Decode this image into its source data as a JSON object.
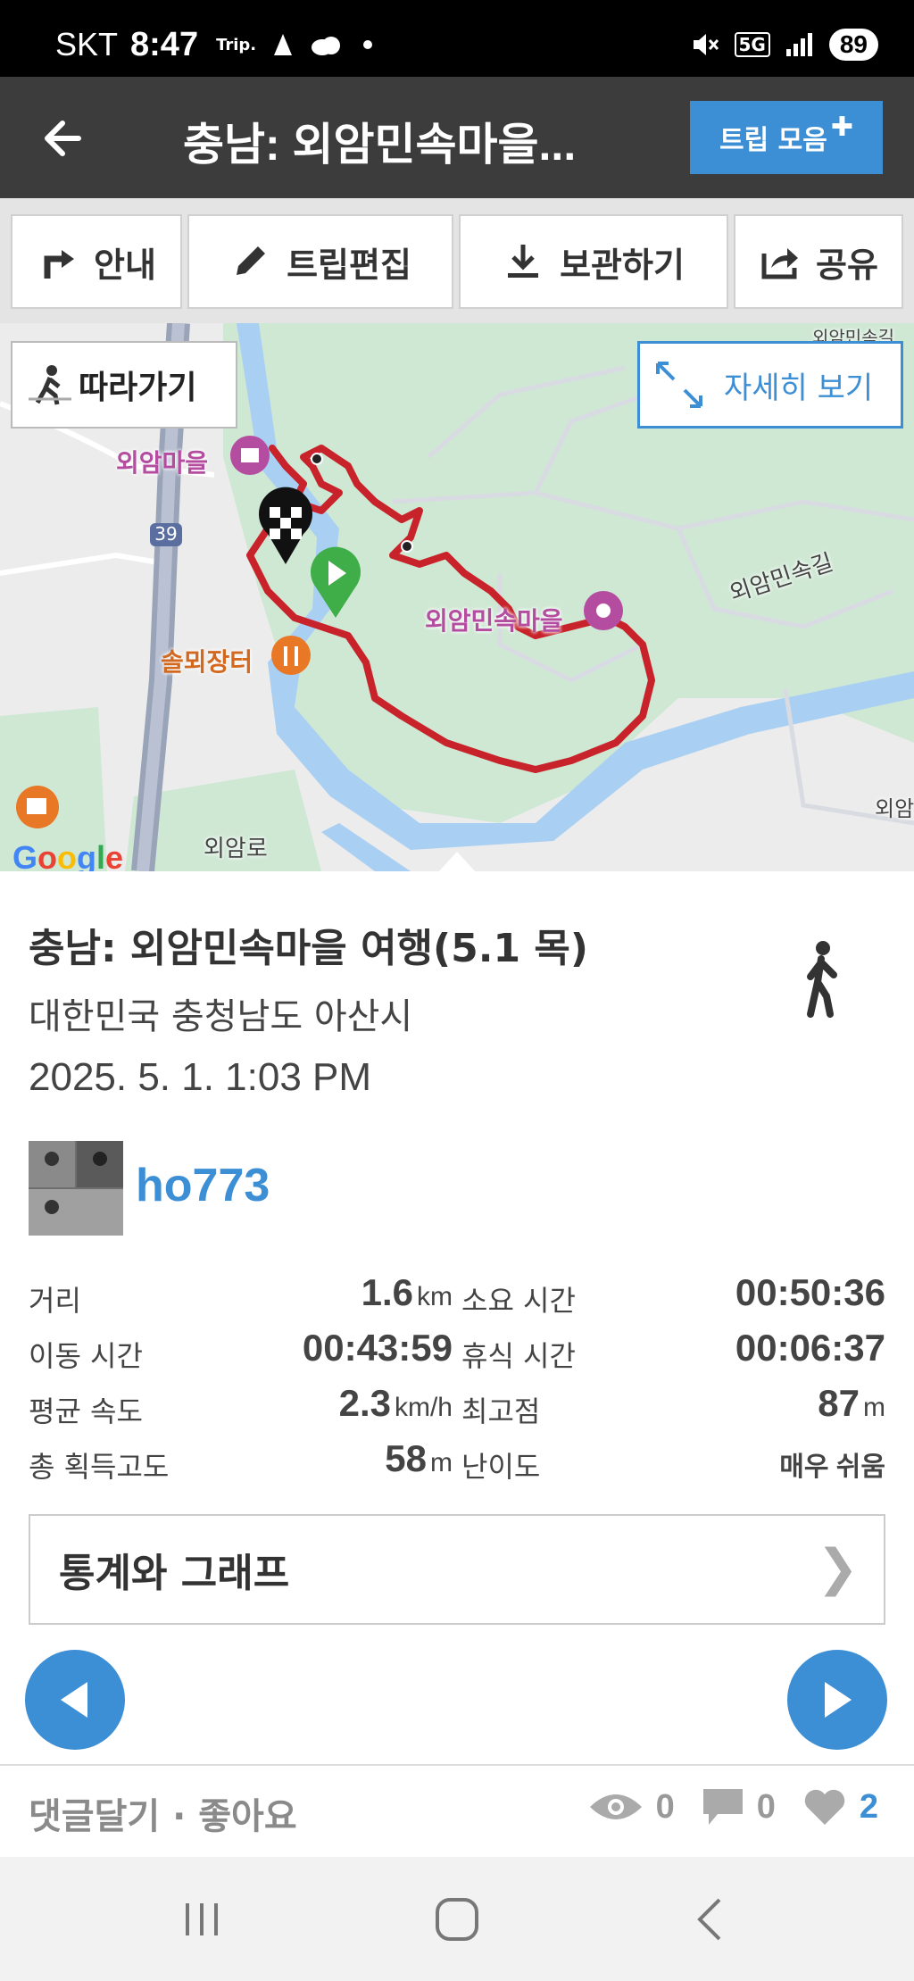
{
  "status_bar": {
    "carrier": "SKT",
    "time": "8:47",
    "trip_label": "Trip.",
    "network": "5G",
    "battery": "89"
  },
  "header": {
    "title": "충남: 외암민속마을...",
    "trip_collection_label": "트립 모음"
  },
  "toolbar": {
    "guide": "안내",
    "edit": "트립편집",
    "save": "보관하기",
    "share": "공유"
  },
  "map": {
    "follow_label": "따라가기",
    "detail_label": "자세히 보기",
    "places": {
      "oeam_village": "외암마을",
      "oeam_folk_village": "외암민속마을",
      "restaurant": "솔뫼장터",
      "street": "외암민속길",
      "road": "외암로",
      "road_number": "39",
      "top_right_road": "외암민속길",
      "edge_label": "외암"
    },
    "colors": {
      "route": "#c8222a",
      "park": "#cfe8d4",
      "water": "#9ec9f0"
    },
    "attribution": "Google"
  },
  "trip": {
    "title": "충남: 외암민속마을 여행(5.1 목)",
    "location": "대한민국 충청남도 아산시",
    "date": "2025. 5. 1. 1:03 PM",
    "activity_icon": "walking-icon",
    "username": "ho773"
  },
  "stats": {
    "distance_label": "거리",
    "distance_value": "1.6",
    "distance_unit": "km",
    "duration_label": "소요 시간",
    "duration_value": "00:50:36",
    "moving_label": "이동 시간",
    "moving_value": "00:43:59",
    "rest_label": "휴식 시간",
    "rest_value": "00:06:37",
    "avg_speed_label": "평균 속도",
    "avg_speed_value": "2.3",
    "avg_speed_unit": "km/h",
    "max_alt_label": "최고점",
    "max_alt_value": "87",
    "max_alt_unit": "m",
    "gain_label": "총 획득고도",
    "gain_value": "58",
    "gain_unit": "m",
    "difficulty_label": "난이도",
    "difficulty_value": "매우 쉬움"
  },
  "stats_graph_label": "통계와 그래프",
  "footer": {
    "comment_like_label": "댓글달기 · 좋아요",
    "views": "0",
    "comments": "0",
    "likes": "2"
  },
  "accent_color": "#3d8fd5"
}
